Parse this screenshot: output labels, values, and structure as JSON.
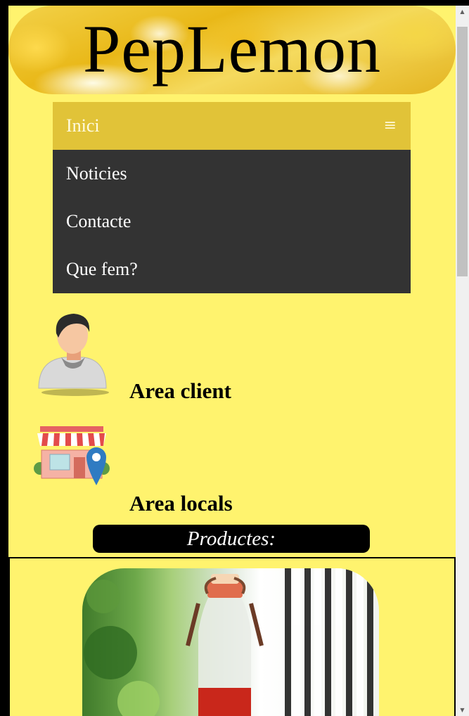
{
  "header": {
    "title": "PepLemon"
  },
  "nav": {
    "items": [
      {
        "label": "Inici"
      },
      {
        "label": "Noticies"
      },
      {
        "label": "Contacte"
      },
      {
        "label": "Que fem?"
      }
    ],
    "menu_icon": "hamburger-icon"
  },
  "areas": [
    {
      "label": "Area client",
      "icon": "user-avatar-icon"
    },
    {
      "label": "Area locals",
      "icon": "shop-location-icon"
    }
  ],
  "products": {
    "heading": "Productes:",
    "image": "bottle-product-image"
  },
  "colors": {
    "page_background": "#FFF36E",
    "nav_active": "#E1C338",
    "nav_background": "#333333",
    "banner": "#000000"
  }
}
